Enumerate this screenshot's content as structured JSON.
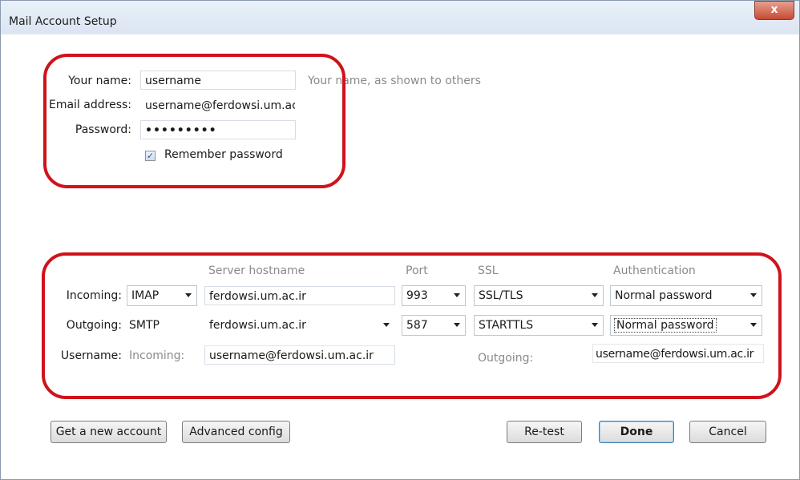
{
  "window": {
    "title": "Mail Account Setup",
    "close_glyph": "x"
  },
  "account": {
    "name_label": "Your name:",
    "name_value": "username",
    "name_hint": "Your name, as shown to others",
    "email_label": "Email address:",
    "email_value": "username@ferdowsi.um.ac.ir",
    "password_label": "Password:",
    "password_value": "•••••••••",
    "remember_label": "Remember password",
    "remember_checked": true
  },
  "server": {
    "headers": {
      "hostname": "Server hostname",
      "port": "Port",
      "ssl": "SSL",
      "auth": "Authentication"
    },
    "incoming": {
      "label": "Incoming:",
      "protocol": "IMAP",
      "hostname": "ferdowsi.um.ac.ir",
      "port": "993",
      "ssl": "SSL/TLS",
      "auth": "Normal password"
    },
    "outgoing": {
      "label": "Outgoing:",
      "protocol": "SMTP",
      "hostname": "ferdowsi.um.ac.ir",
      "port": "587",
      "ssl": "STARTTLS",
      "auth": "Normal password"
    },
    "username": {
      "label": "Username:",
      "incoming_label": "Incoming:",
      "incoming_value": "username@ferdowsi.um.ac.ir",
      "outgoing_label": "Outgoing:",
      "outgoing_value": "username@ferdowsi.um.ac.ir"
    }
  },
  "buttons": {
    "new_account": "Get a new account",
    "advanced": "Advanced config",
    "retest": "Re-test",
    "done": "Done",
    "cancel": "Cancel"
  },
  "colors": {
    "highlight": "#d0121b"
  }
}
